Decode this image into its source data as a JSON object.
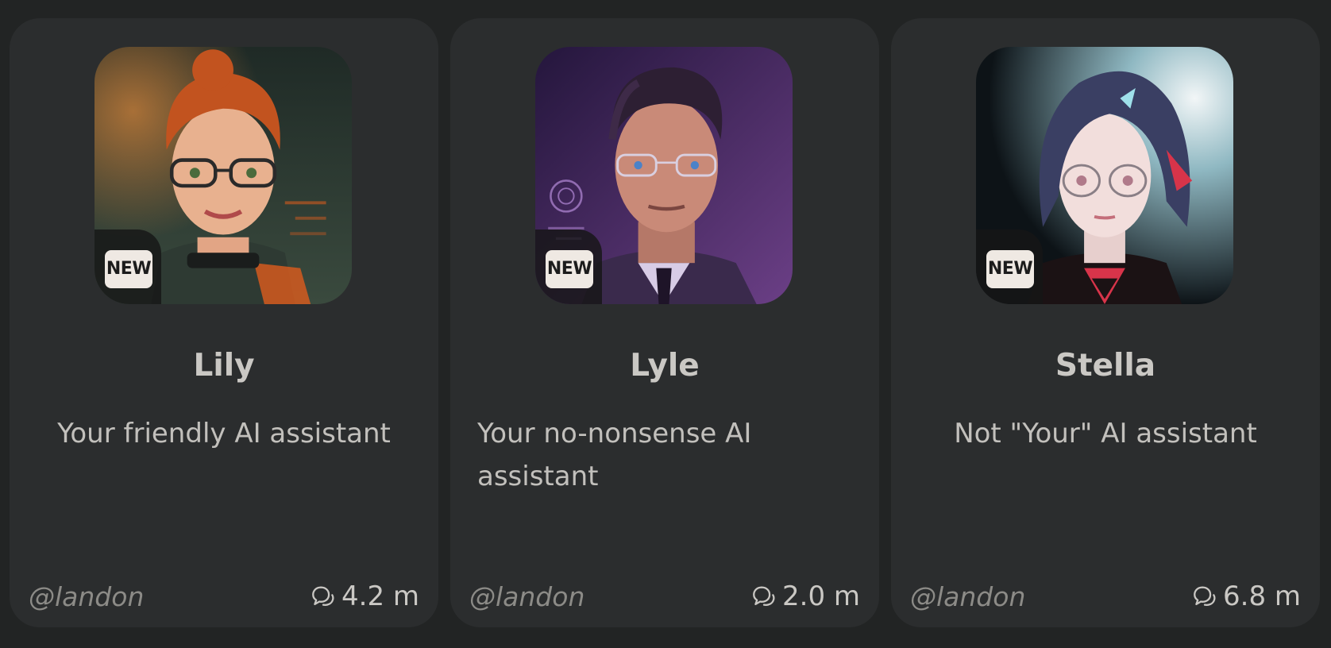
{
  "characters": [
    {
      "name": "Lily",
      "description": "Your friendly AI assistant",
      "badge": "NEW",
      "author": "@landon",
      "interactions": "4.2 m",
      "icon": "chat-bubbles-icon",
      "colors": {
        "bg_top": "#1f2a26",
        "bg_bottom": "#3a4a3e",
        "hair": "#c2531f",
        "skin": "#e8b18f",
        "jacket": "#2e3a33",
        "accent": "#d35b1e"
      }
    },
    {
      "name": "Lyle",
      "description": "Your no-nonsense AI assistant",
      "badge": "NEW",
      "author": "@landon",
      "interactions": "2.0 m",
      "icon": "chat-bubbles-icon",
      "colors": {
        "bg_top": "#24163c",
        "bg_bottom": "#6b3f86",
        "hair": "#2d1f33",
        "skin": "#c98a78",
        "jacket": "#3a2a4c",
        "accent": "#b58ad8"
      }
    },
    {
      "name": "Stella",
      "description": "Not \"Your\" AI assistant",
      "badge": "NEW",
      "author": "@landon",
      "interactions": "6.8 m",
      "icon": "chat-bubbles-icon",
      "colors": {
        "bg_top": "#0d1317",
        "bg_bottom": "#d9ecef",
        "hair": "#3a3f63",
        "skin": "#f2dedc",
        "jacket": "#1b1214",
        "accent": "#d8344a"
      }
    }
  ]
}
